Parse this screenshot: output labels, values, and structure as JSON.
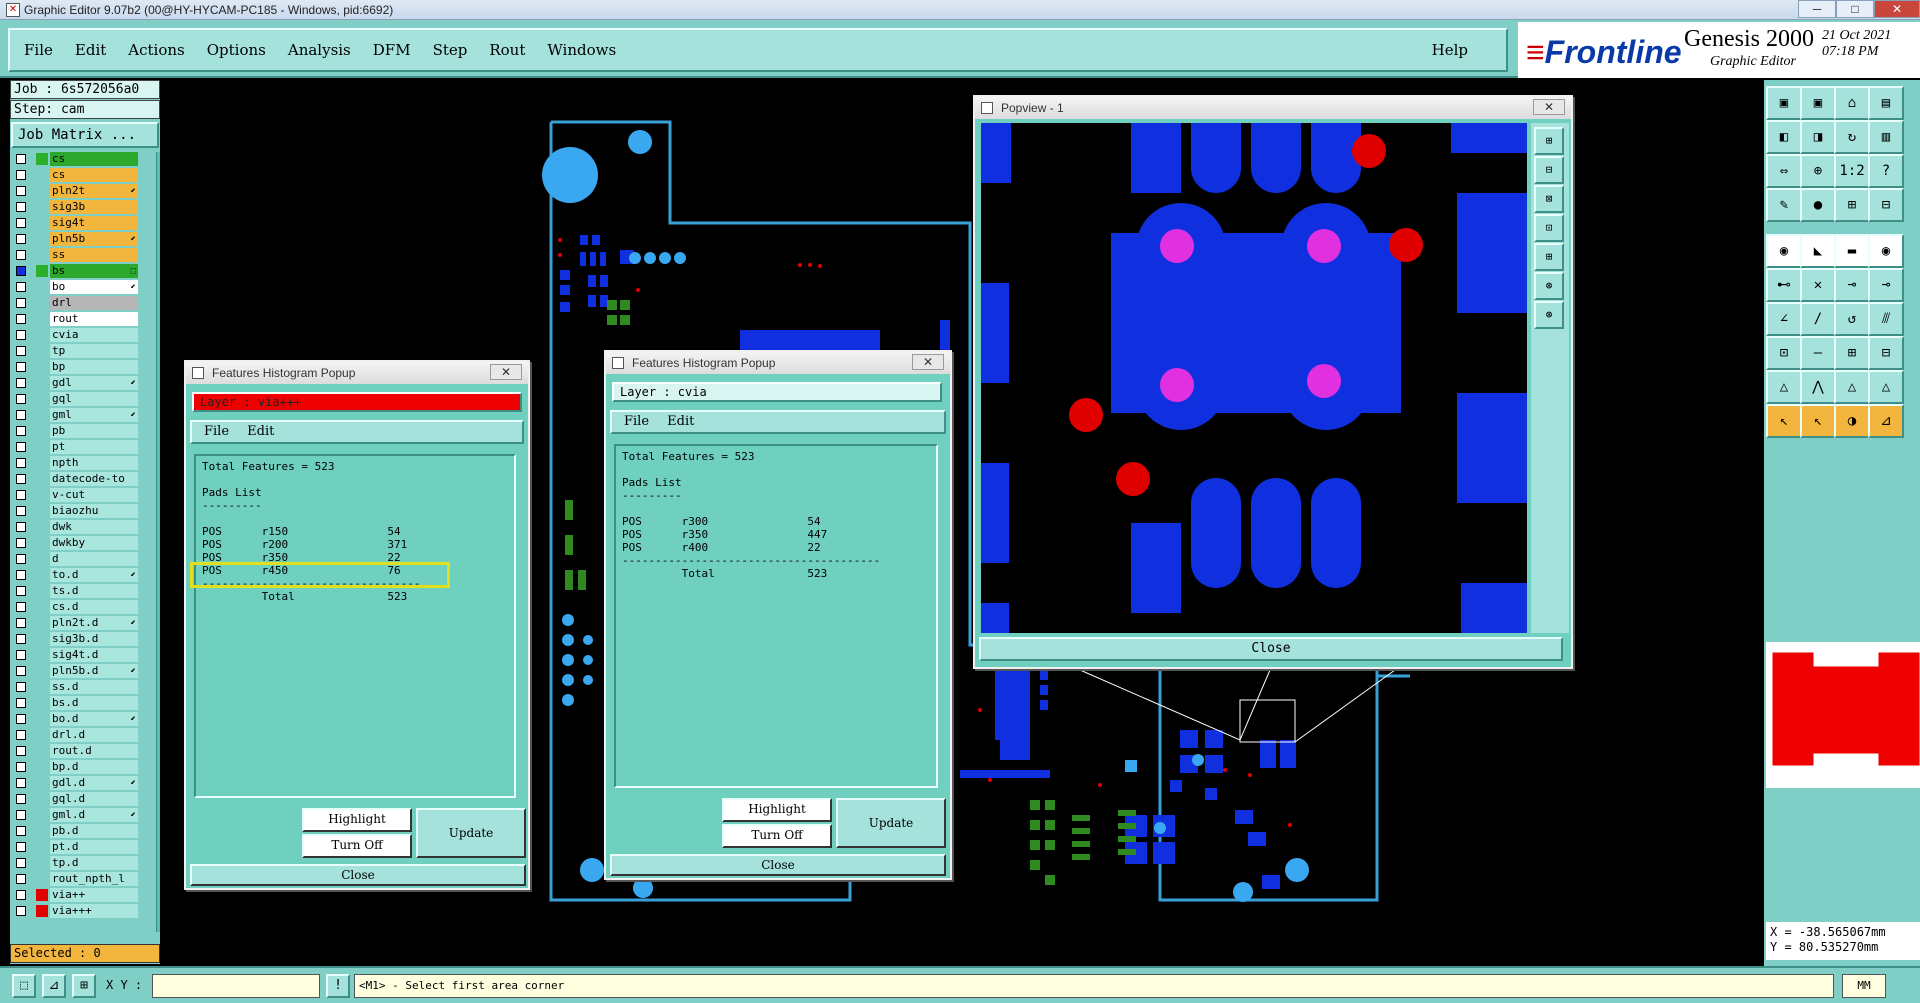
{
  "window": {
    "title": "Graphic Editor 9.07b2 (00@HY-HYCAM-PC185 - Windows, pid:6692)",
    "minimize": "─",
    "maximize": "□",
    "close": "✕"
  },
  "menubar": {
    "items": [
      "File",
      "Edit",
      "Actions",
      "Options",
      "Analysis",
      "DFM",
      "Step",
      "Rout",
      "Windows"
    ],
    "help": "Help"
  },
  "brand": {
    "logo_prefix": "≡",
    "logo": "Frontline",
    "product": "Genesis 2000",
    "subtitle": "Graphic Editor",
    "date": "21 Oct 2021",
    "time": "07:18 PM"
  },
  "job": {
    "job_label": "Job : 6s572056a0",
    "step_label": "Step: cam",
    "matrix_button": "Job Matrix ..."
  },
  "layers": [
    {
      "name": "cs",
      "color": "green",
      "style": "gr"
    },
    {
      "name": "cs",
      "color": "orange",
      "style": "or"
    },
    {
      "name": "pln2t",
      "color": "orange",
      "style": "or",
      "mark": "⬋"
    },
    {
      "name": "sig3b",
      "color": "orange",
      "style": "or"
    },
    {
      "name": "sig4t",
      "color": "orange",
      "style": "or"
    },
    {
      "name": "pln5b",
      "color": "orange",
      "style": "or",
      "mark": "⬋"
    },
    {
      "name": "ss",
      "color": "orange",
      "style": "or"
    },
    {
      "name": "bs",
      "color": "green",
      "style": "gr",
      "mark": "⬚",
      "selected": true
    },
    {
      "name": "bo",
      "color": "white",
      "style": "wh",
      "mark": "⬋"
    },
    {
      "name": "drl",
      "color": "gray",
      "style": "gy"
    },
    {
      "name": "rout",
      "color": "light",
      "style": "wh"
    },
    {
      "name": "cvia"
    },
    {
      "name": "tp"
    },
    {
      "name": "bp"
    },
    {
      "name": "gdl",
      "mark": "⬋"
    },
    {
      "name": "gql"
    },
    {
      "name": "gml",
      "mark": "⬋"
    },
    {
      "name": "pb"
    },
    {
      "name": "pt"
    },
    {
      "name": "npth"
    },
    {
      "name": "datecode-to"
    },
    {
      "name": "v-cut"
    },
    {
      "name": "biaozhu"
    },
    {
      "name": "dwk"
    },
    {
      "name": "dwkby"
    },
    {
      "name": "d"
    },
    {
      "name": "to.d",
      "mark": "⬋"
    },
    {
      "name": "ts.d"
    },
    {
      "name": "cs.d"
    },
    {
      "name": "pln2t.d",
      "mark": "⬋"
    },
    {
      "name": "sig3b.d"
    },
    {
      "name": "sig4t.d"
    },
    {
      "name": "pln5b.d",
      "mark": "⬋"
    },
    {
      "name": "ss.d"
    },
    {
      "name": "bs.d"
    },
    {
      "name": "bo.d",
      "mark": "⬋"
    },
    {
      "name": "drl.d"
    },
    {
      "name": "rout.d"
    },
    {
      "name": "bp.d"
    },
    {
      "name": "gdl.d",
      "mark": "⬋"
    },
    {
      "name": "gql.d"
    },
    {
      "name": "gml.d",
      "mark": "⬋"
    },
    {
      "name": "pb.d"
    },
    {
      "name": "pt.d"
    },
    {
      "name": "tp.d"
    },
    {
      "name": "rout_npth_l"
    },
    {
      "name": "via++",
      "swatch": "red"
    },
    {
      "name": "via+++",
      "swatch": "red"
    }
  ],
  "selected_label": "Selected : 0",
  "status": {
    "xy_label": "X Y :",
    "xy_value": "",
    "alert_icon": "!",
    "message": "<M1> - Select first area corner",
    "units": "MM"
  },
  "coords": {
    "x": "X = -38.565067mm",
    "y": "Y = 80.535270mm"
  },
  "histogram1": {
    "title": "Features Histogram Popup",
    "layer_label": "Layer :  via+++",
    "menu": [
      "File",
      "Edit"
    ],
    "text": "Total Features = 523\n\nPads List\n---------\n\nPOS      r150               54\nPOS      r200               371\nPOS      r350               22\nPOS      r450               76\n---------------------------------\n         Total              523",
    "highlight": "Highlight",
    "turn_off": "Turn Off",
    "update": "Update",
    "close": "Close"
  },
  "histogram2": {
    "title": "Features Histogram Popup",
    "layer_label": "Layer :  cvia",
    "menu": [
      "File",
      "Edit"
    ],
    "text": "Total Features = 523\n\nPads List\n---------\n\nPOS      r300               54\nPOS      r350               447\nPOS      r400               22\n---------------------------------------\n         Total              523",
    "highlight": "Highlight",
    "turn_off": "Turn Off",
    "update": "Update",
    "close": "Close"
  },
  "popview": {
    "title": "Popview - 1",
    "close": "Close",
    "side_buttons": [
      "⊞",
      "⊟",
      "⊠",
      "⊡",
      "⊞",
      "⊛",
      "⊛"
    ]
  },
  "toolbar": {
    "rows": [
      [
        "▣",
        "▣",
        "⌂",
        "▤"
      ],
      [
        "◧",
        "◨",
        "↻",
        "▥"
      ],
      [
        "⇔",
        "⊕",
        "1:2",
        "?"
      ],
      [
        "✎",
        "●",
        "⊞",
        "⊟"
      ],
      [
        "◉",
        "◣",
        "▬",
        "◉"
      ],
      [
        "⊷",
        "✕",
        "⊸",
        "⊸"
      ],
      [
        "∠",
        "/",
        "↺",
        "⫻"
      ],
      [
        "⊡",
        "—",
        "⊞",
        "⊟"
      ],
      [
        "△",
        "⋀",
        "△",
        "△"
      ],
      [
        "↖",
        "↖",
        "◑",
        "⊿"
      ]
    ]
  },
  "colors": {
    "panel": "#7fcfc6",
    "pad_blue": "#1030e0",
    "pad_red": "#e00000",
    "pad_magenta": "#e030e0",
    "outline": "#39a0d8",
    "green_pad": "#2f8a1f"
  }
}
